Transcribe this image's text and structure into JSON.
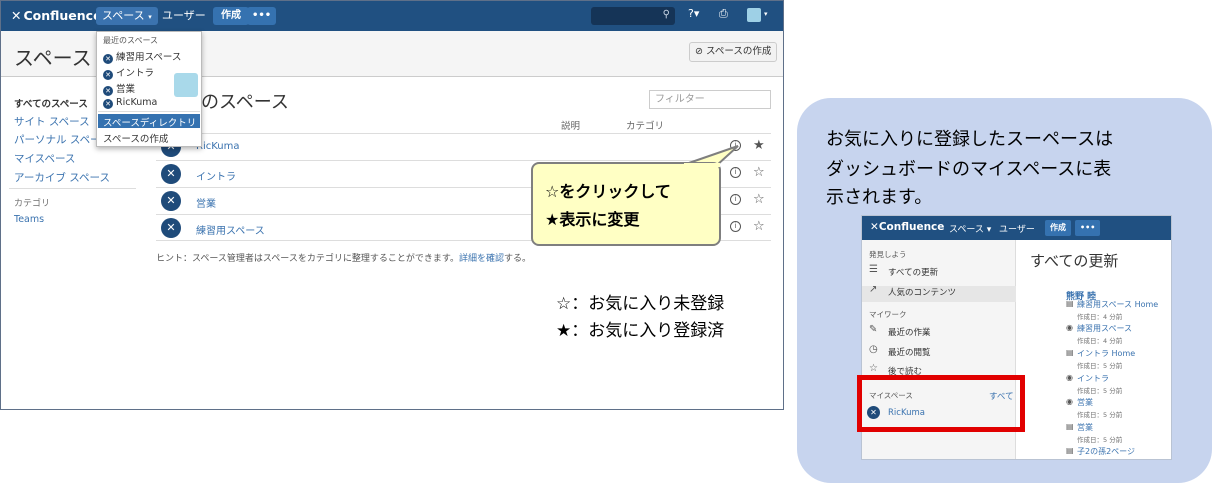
{
  "topnav": {
    "logo": "Confluence",
    "spaces_menu": "スペース",
    "people": "ユーザー",
    "create": "作成",
    "more": "•••"
  },
  "header": {
    "title": "スペース デ",
    "create_space_button": "スペースの作成"
  },
  "sidebar": {
    "all_spaces": "すべてのスペース",
    "items": [
      "サイト スペース",
      "パーソナル スペース",
      "マイスペース",
      "アーカイブ スペース"
    ],
    "category_heading": "カテゴリ",
    "categories": [
      "Teams"
    ]
  },
  "main": {
    "heading": "のスペース",
    "filter_placeholder": "フィルター",
    "col_description": "説明",
    "col_category": "カテゴリ",
    "rows": [
      {
        "name": "RicKuma",
        "star": "★"
      },
      {
        "name": "イントラ",
        "star": "☆"
      },
      {
        "name": "営業",
        "star": "☆"
      },
      {
        "name": "練習用スペース",
        "star": "☆"
      }
    ],
    "hint_text": "ヒント：スペース管理者はスペースをカテゴリに整理することができます。",
    "hint_link": "詳細を確認",
    "hint_end": "する。"
  },
  "dropdown": {
    "heading": "最近のスペース",
    "items": [
      "練習用スペース",
      "イントラ",
      "営業",
      "RicKuma"
    ],
    "directory": "スペースディレクトリ",
    "create": "スペースの作成"
  },
  "callout": {
    "line1": "☆をクリックして",
    "line2": "★表示に変更"
  },
  "legend": {
    "line1": "☆：お気に入り未登録",
    "line2": "★：お気に入り登録済"
  },
  "explanation": {
    "line1": "お気に入りに登録したスーペースは",
    "line2": "ダッシュボードのマイスペースに表",
    "line3": "示されます。"
  },
  "mini": {
    "logo": "Confluence",
    "spaces": "スペース",
    "people": "ユーザー",
    "create": "作成",
    "more": "•••",
    "discover": "発見しよう",
    "all_updates": "すべての更新",
    "popular": "人気のコンテンツ",
    "my_work": "マイワーク",
    "recent_work": "最近の作業",
    "recently_viewed": "最近の閲覧",
    "read_later": "後で読む",
    "my_spaces": "マイスペース",
    "all": "すべて",
    "my_space_item": "RicKuma",
    "title": "すべての更新",
    "user": "熊野 睦",
    "feed": [
      {
        "name": "練習用スペース Home",
        "sub": "作成日：4 分前"
      },
      {
        "name": "練習用スペース",
        "sub": "作成日：4 分前"
      },
      {
        "name": "イントラ Home",
        "sub": "作成日：5 分前"
      },
      {
        "name": "イントラ",
        "sub": "作成日：5 分前"
      },
      {
        "name": "営業",
        "sub": "作成日：5 分前"
      },
      {
        "name": "営業",
        "sub": "作成日：5 分前"
      },
      {
        "name": "子2の孫2ページ",
        "sub": ""
      }
    ]
  }
}
